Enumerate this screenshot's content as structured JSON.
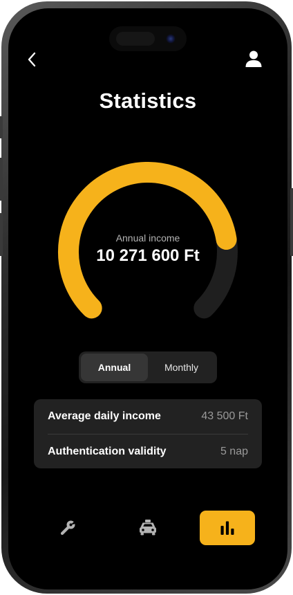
{
  "header": {
    "title": "Statistics",
    "back_icon": "chevron-left-icon",
    "profile_icon": "user-icon"
  },
  "gauge": {
    "label": "Annual income",
    "value": "10 271 600 Ft",
    "fill_fraction": 0.8,
    "accent_color": "#f6b21b",
    "track_color": "#1f1f1f"
  },
  "period_toggle": {
    "options": [
      "Annual",
      "Monthly"
    ],
    "selected": "Annual"
  },
  "stats": {
    "rows": [
      {
        "label": "Average daily income",
        "value": "43 500 Ft"
      },
      {
        "label": "Authentication validity",
        "value": "5 nap"
      }
    ]
  },
  "bottom_nav": {
    "items": [
      {
        "icon": "wrench-icon",
        "active": false
      },
      {
        "icon": "taxi-icon",
        "active": false
      },
      {
        "icon": "bar-chart-icon",
        "active": true
      }
    ]
  }
}
